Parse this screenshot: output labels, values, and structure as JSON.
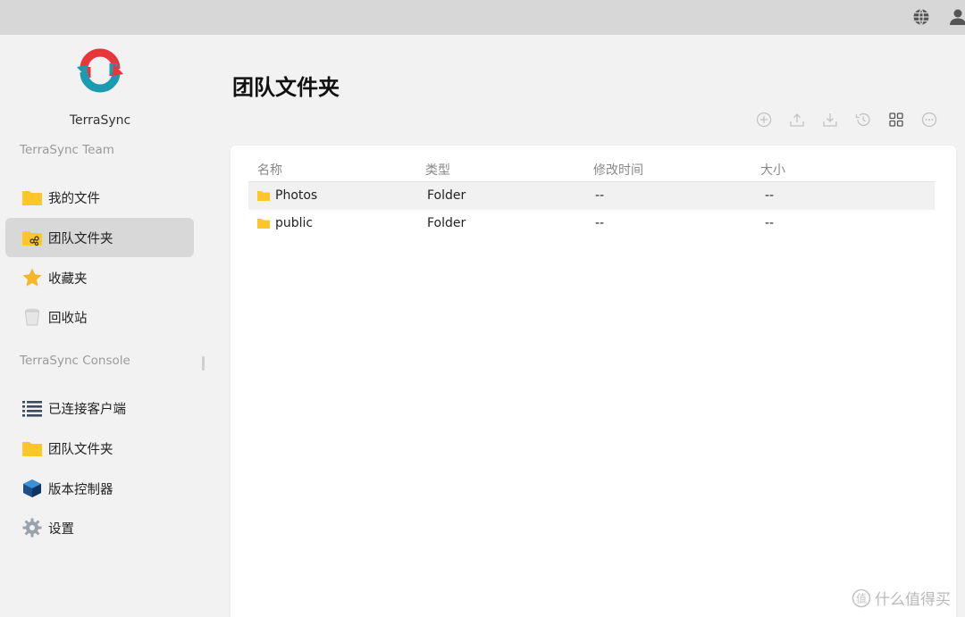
{
  "app": {
    "name": "TerraSync"
  },
  "sidebar": {
    "team_section": "TerraSync Team",
    "team_items": [
      {
        "label": "我的文件",
        "icon": "folder-icon"
      },
      {
        "label": "团队文件夹",
        "icon": "shared-folder-icon",
        "active": true
      },
      {
        "label": "收藏夹",
        "icon": "star-icon"
      },
      {
        "label": "回收站",
        "icon": "trash-icon"
      }
    ],
    "console_section": "TerraSync Console",
    "console_items": [
      {
        "label": "已连接客户端",
        "icon": "list-icon"
      },
      {
        "label": "团队文件夹",
        "icon": "folder-icon"
      },
      {
        "label": "版本控制器",
        "icon": "cube-icon"
      },
      {
        "label": "设置",
        "icon": "gear-icon"
      }
    ]
  },
  "main": {
    "title": "团队文件夹",
    "toolbar": [
      "add-icon",
      "upload-icon",
      "download-icon",
      "history-icon",
      "grid-view-icon",
      "more-icon"
    ],
    "columns": [
      "名称",
      "类型",
      "修改时间",
      "大小"
    ],
    "rows": [
      {
        "name": "Photos",
        "type": "Folder",
        "modified": "--",
        "size": "--"
      },
      {
        "name": "public",
        "type": "Folder",
        "modified": "--",
        "size": "--"
      }
    ]
  },
  "watermark": {
    "text": "什么值得买"
  },
  "colors": {
    "folder": "#ffc52b",
    "logo_red": "#e8363a",
    "logo_teal": "#1a9bb0",
    "active_bg": "#d8d8d8"
  }
}
